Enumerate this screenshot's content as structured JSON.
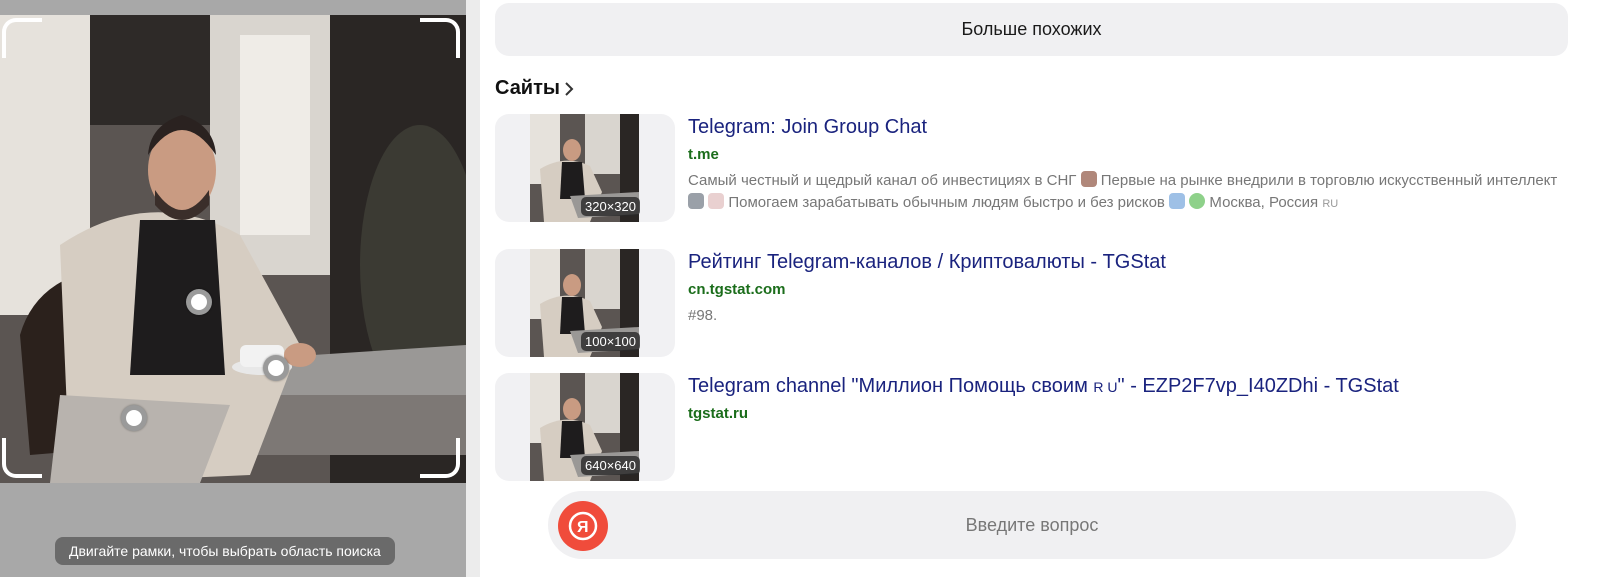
{
  "left_panel": {
    "hint": "Двигайте рамки, чтобы выбрать область поиска"
  },
  "more_similar_label": "Больше похожих",
  "sites_heading": "Сайты",
  "results": [
    {
      "title": "Telegram: Join Group Chat",
      "domain": "t.me",
      "dims": "320×320",
      "desc_part1": "Самый честный и щедрый канал об инвестициях в СНГ",
      "desc_part2": "Первые на рынке внедрили в торговлю искусственный интеллект",
      "desc_part3": "Помогаем зарабатывать обычным людям быстро и без рисков",
      "desc_part4": "Москва, Россия",
      "lang": "RU"
    },
    {
      "title": "Рейтинг Telegram-каналов / Криптовалюты - TGStat",
      "domain": "cn.tgstat.com",
      "dims": "100×100",
      "desc": "#98."
    },
    {
      "title_part1": "Telegram channel \"Миллион Помощь своим",
      "title_small": "R U",
      "title_part2": "\" - EZP2F7vp_I40ZDhi - TGStat",
      "domain": "tgstat.ru",
      "dims": "640×640"
    }
  ],
  "ask": {
    "placeholder": "Введите вопрос"
  },
  "colors": {
    "link": "#1a237e",
    "domain": "#1b6d1b",
    "logo": "#f04c3b"
  }
}
